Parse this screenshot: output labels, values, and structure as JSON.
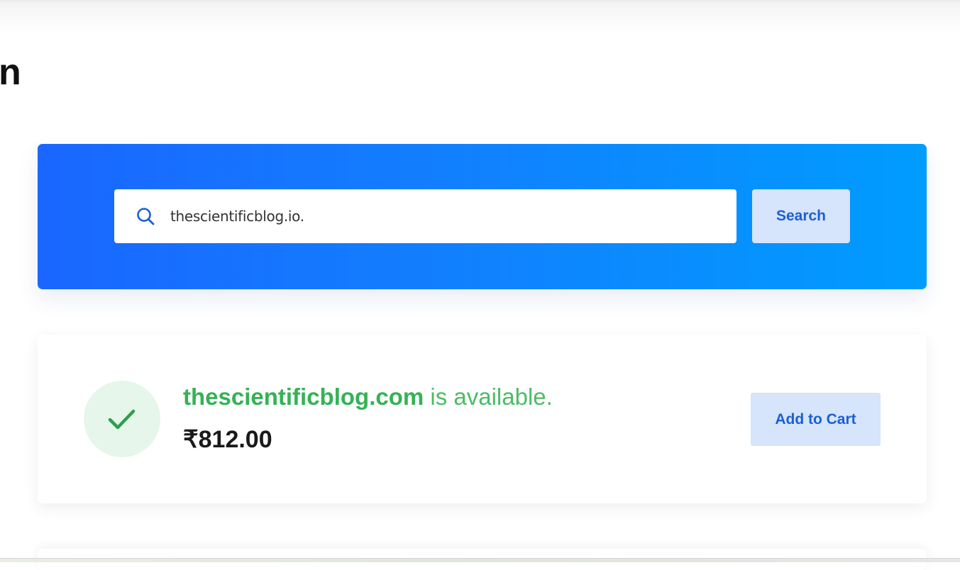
{
  "header": {
    "heading_fragment": "n"
  },
  "search": {
    "value": "thescientificblog.io.",
    "placeholder": "",
    "button_label": "Search",
    "icon": "search-icon"
  },
  "result": {
    "domain": "thescientificblog.com",
    "status_text": " is available.",
    "price": "₹812.00",
    "status_icon": "check-icon",
    "add_to_cart_label": "Add to Cart"
  },
  "colors": {
    "panel_gradient_start": "#1a66ff",
    "panel_gradient_end": "#009cff",
    "button_bg": "#d6e4fc",
    "button_text": "#1a5fd6",
    "available_green": "#34b256",
    "check_circle_bg": "#e6f6ea"
  }
}
